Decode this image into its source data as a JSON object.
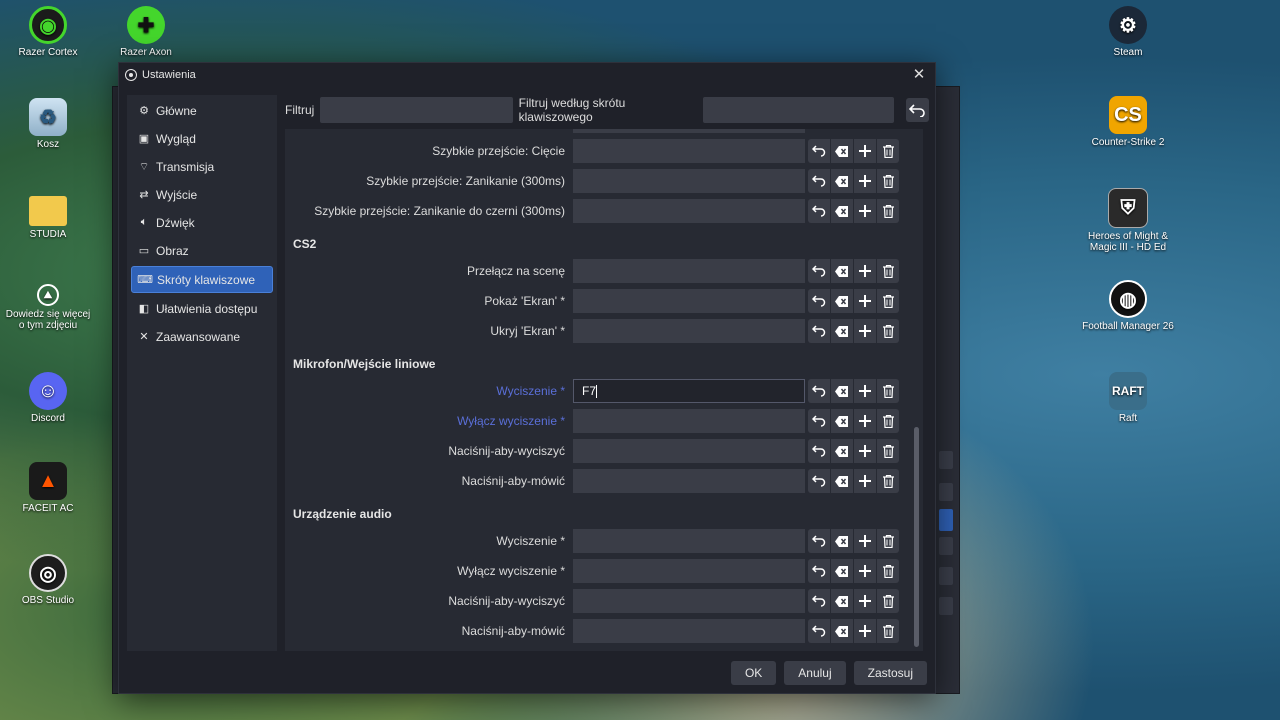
{
  "desktop": {
    "icons": [
      {
        "label": "Razer Cortex",
        "name": "razer-cortex-icon"
      },
      {
        "label": "Razer Axon",
        "name": "razer-axon-icon"
      },
      {
        "label": "Kosz",
        "name": "recycle-bin-icon"
      },
      {
        "label": "STUDIA",
        "name": "folder-icon"
      },
      {
        "label": "Dowiedz się więcej o tym zdjęciu",
        "name": "camera-info-icon"
      },
      {
        "label": "Discord",
        "name": "discord-icon"
      },
      {
        "label": "FACEIT AC",
        "name": "faceit-icon"
      },
      {
        "label": "OBS Studio",
        "name": "obs-studio-icon"
      },
      {
        "label": "Steam",
        "name": "steam-icon"
      },
      {
        "label": "Counter-Strike 2",
        "name": "cs2-icon"
      },
      {
        "label": "Heroes of Might & Magic III - HD Ed",
        "name": "heroes-icon"
      },
      {
        "label": "Football Manager 26",
        "name": "football-manager-icon"
      },
      {
        "label": "Raft",
        "name": "raft-icon"
      }
    ]
  },
  "dialog": {
    "title": "Ustawienia",
    "sidebar": [
      {
        "label": "Główne",
        "icon": "gear-icon"
      },
      {
        "label": "Wygląd",
        "icon": "appearance-icon"
      },
      {
        "label": "Transmisja",
        "icon": "broadcast-icon"
      },
      {
        "label": "Wyjście",
        "icon": "output-icon"
      },
      {
        "label": "Dźwięk",
        "icon": "speaker-icon"
      },
      {
        "label": "Obraz",
        "icon": "monitor-icon"
      },
      {
        "label": "Skróty klawiszowe",
        "icon": "keyboard-icon"
      },
      {
        "label": "Ułatwienia dostępu",
        "icon": "accessibility-icon"
      },
      {
        "label": "Zaawansowane",
        "icon": "tools-icon"
      }
    ],
    "active_item": "Skróty klawiszowe",
    "filter": {
      "label": "Filtruj",
      "value": "",
      "hotkey_label": "Filtruj według skrótu klawiszowego",
      "hotkey_value": ""
    },
    "rows_top": [
      {
        "label": "Szybkie przejście: Cięcie",
        "value": ""
      },
      {
        "label": "Szybkie przejście: Zanikanie (300ms)",
        "value": ""
      },
      {
        "label": "Szybkie przejście: Zanikanie do czerni (300ms)",
        "value": ""
      }
    ],
    "sections": [
      {
        "title": "CS2",
        "rows": [
          {
            "label": "Przełącz na scenę",
            "value": ""
          },
          {
            "label": "Pokaż 'Ekran' *",
            "value": ""
          },
          {
            "label": "Ukryj 'Ekran' *",
            "value": ""
          }
        ]
      },
      {
        "title": "Mikrofon/Wejście liniowe",
        "rows": [
          {
            "label": "Wyciszenie *",
            "value": "F7",
            "highlight": true,
            "focused": true
          },
          {
            "label": "Wyłącz wyciszenie *",
            "value": "",
            "highlight": true
          },
          {
            "label": "Naciśnij-aby-wyciszyć",
            "value": ""
          },
          {
            "label": "Naciśnij-aby-mówić",
            "value": ""
          }
        ]
      },
      {
        "title": "Urządzenie audio",
        "rows": [
          {
            "label": "Wyciszenie *",
            "value": ""
          },
          {
            "label": "Wyłącz wyciszenie *",
            "value": ""
          },
          {
            "label": "Naciśnij-aby-wyciszyć",
            "value": ""
          },
          {
            "label": "Naciśnij-aby-mówić",
            "value": ""
          }
        ]
      }
    ],
    "row_buttons": [
      "revert-icon",
      "clear-icon",
      "add-icon",
      "trash-icon"
    ],
    "footer": {
      "ok": "OK",
      "cancel": "Anuluj",
      "apply": "Zastosuj"
    }
  }
}
